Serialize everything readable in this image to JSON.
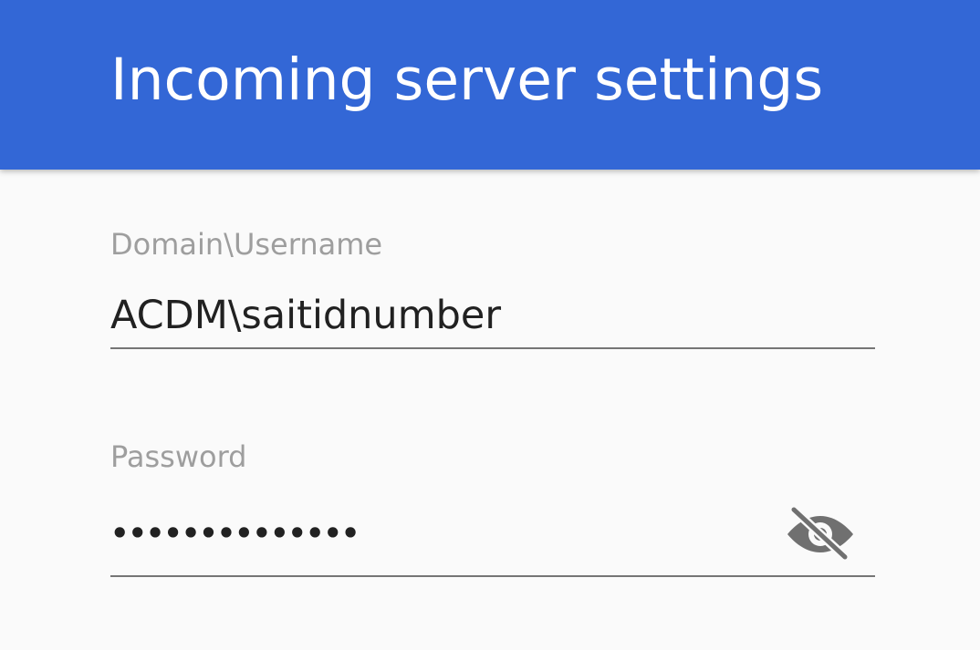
{
  "header": {
    "title": "Incoming server settings",
    "background_color": "#3367d6"
  },
  "username": {
    "label": "Domain\\Username",
    "value": "ACDM\\saitidnumber"
  },
  "password": {
    "label": "Password",
    "value": "••••••••••••••",
    "toggle_icon": "visibility-off-icon"
  }
}
